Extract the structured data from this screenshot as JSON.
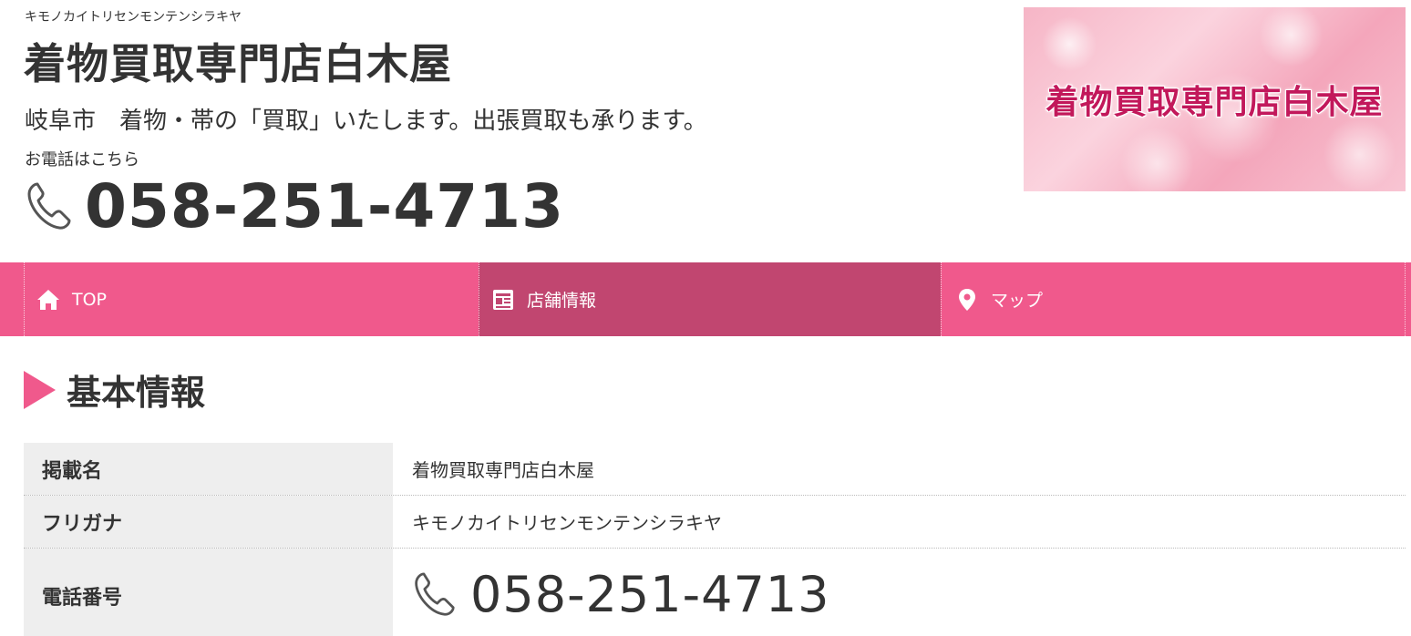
{
  "header": {
    "furigana": "キモノカイトリセンモンテンシラキヤ",
    "title": "着物買取専門店白木屋",
    "tagline": "岐阜市　着物・帯の「買取」いたします。出張買取も承ります。",
    "phone_caption": "お電話はこちら",
    "phone": "058-251-4713",
    "phone_icon": "phone-icon",
    "banner_text": "着物買取専門店白木屋"
  },
  "nav": {
    "items": [
      {
        "label": "TOP",
        "icon": "home-icon"
      },
      {
        "label": "店舗情報",
        "icon": "store-info-icon"
      },
      {
        "label": "マップ",
        "icon": "map-pin-icon"
      }
    ]
  },
  "section": {
    "title": "基本情報"
  },
  "info": {
    "rows": [
      {
        "label": "掲載名",
        "value": "着物買取専門店白木屋"
      },
      {
        "label": "フリガナ",
        "value": "キモノカイトリセンモンテンシラキヤ"
      },
      {
        "label": "電話番号",
        "value": "058-251-4713"
      }
    ]
  },
  "colors": {
    "accent": "#f0598c",
    "accent_active": "#c14670",
    "label_bg": "#eeeeee",
    "text": "#333333"
  }
}
